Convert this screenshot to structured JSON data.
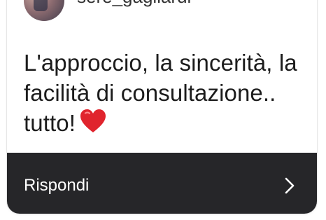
{
  "header": {
    "username": "sere_gagliardi"
  },
  "message": {
    "text": "L'approccio, la sincerità, la facilità di consultazione.. tutto!",
    "emoji_icon": "red-heart-icon",
    "heart_color": "#e0242d"
  },
  "reply": {
    "label": "Rispondi",
    "icon": "chevron-right-icon",
    "bar_color": "#262629"
  }
}
